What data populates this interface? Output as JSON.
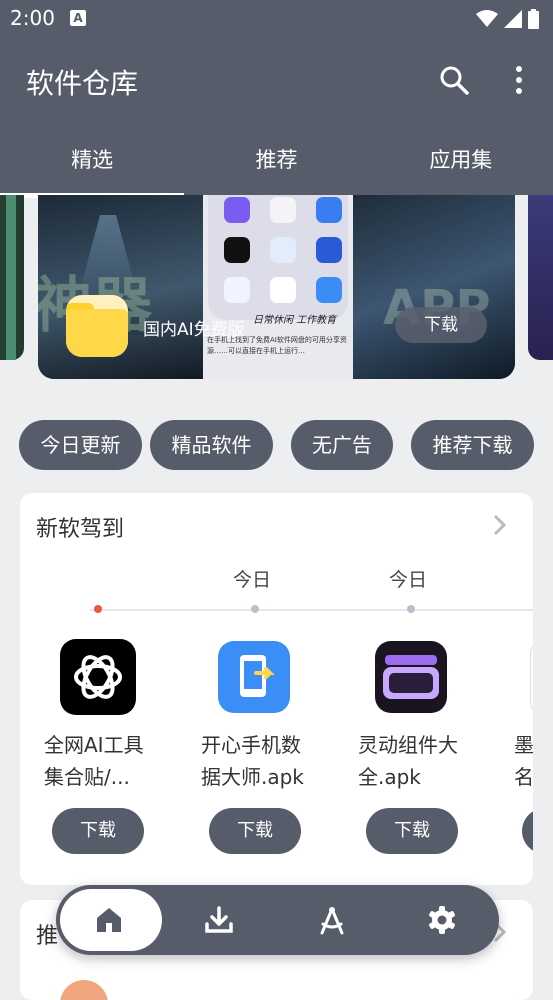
{
  "status_bar": {
    "time": "2:00",
    "notif_badge": "A"
  },
  "app_bar": {
    "title": "软件仓库"
  },
  "tabs": [
    {
      "label": "精选",
      "active": true
    },
    {
      "label": "推荐",
      "active": false
    },
    {
      "label": "应用集",
      "active": false
    }
  ],
  "banner": {
    "app_name": "国内AI免费版",
    "download_label": "下载",
    "caption": "日常休闲 工作教育",
    "text": "在手机上找到了免费AI软件网盘的可用分享资源……可以直接在手机上运行…",
    "bg_text_left": "神器",
    "bg_text_right": "APP"
  },
  "chips": [
    "今日更新",
    "精品软件",
    "无广告",
    "推荐下载"
  ],
  "new_software": {
    "title": "新软驾到",
    "timeline_labels": [
      "",
      "今日",
      "今日"
    ],
    "items": [
      {
        "name_line1": "全网AI工具",
        "name_line2": "集合贴/...",
        "download_label": "下载",
        "icon": "openai-icon"
      },
      {
        "name_line1": "开心手机数",
        "name_line2": "据大师.apk",
        "download_label": "下载",
        "icon": "phone-transfer-icon"
      },
      {
        "name_line1": "灵动组件大",
        "name_line2": "全.apk",
        "download_label": "下载",
        "icon": "widget-icon"
      },
      {
        "name_line1": "墨",
        "name_line2": "名",
        "download_label": "下载",
        "icon": "partial-icon"
      }
    ]
  },
  "second_section": {
    "title": "推"
  },
  "bottom_nav": [
    "home-icon",
    "download-icon",
    "compass-icon",
    "settings-icon"
  ],
  "colors": {
    "header": "#565c6a",
    "accent_dot": "#ee5544",
    "background": "#edeef0"
  }
}
